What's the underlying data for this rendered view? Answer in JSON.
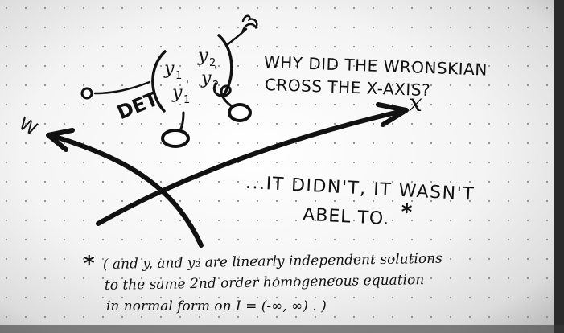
{
  "drawing": {
    "formula": {
      "prefix": "DET",
      "row1_left": "y",
      "row1_left_sub": "1",
      "row1_right": "y",
      "row1_right_sub": "2",
      "row2_left": "y",
      "row2_left_sub": "1",
      "row2_left_prime": "'",
      "row2_right": "y",
      "row2_right_sub": "2",
      "row2_right_prime": "'"
    },
    "question": {
      "line1": "WHY DID THE WRONSKIAN",
      "line2": "CROSS THE X-AXIS?"
    },
    "axes": {
      "x_label": "x",
      "w_label": "W"
    },
    "punchline": {
      "line1": "...IT DIDN'T, IT WASN'T",
      "line2": "ABEL TO.",
      "asterisk": "*"
    },
    "footnote": {
      "asterisk": "*",
      "line1": "( and y, and y₂ are linearly independent solutions",
      "line2": "to the same 2nd order homogeneous equation",
      "line3": "in normal form on I = (-∞, ∞) . )"
    }
  }
}
